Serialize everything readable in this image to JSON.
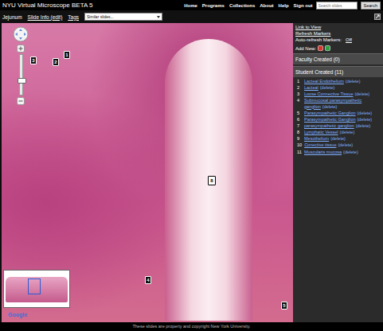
{
  "header": {
    "title": "NYU Virtual Microscope BETA 5",
    "nav": [
      "Home",
      "Programs",
      "Collections",
      "About",
      "Help",
      "Sign out"
    ],
    "search": {
      "placeholder": "Search slides",
      "button": "Search"
    }
  },
  "toolbar": {
    "slide": "Jejunum",
    "slide_info": "Slide Info (edit)",
    "tags": "Tags",
    "similar": "Similar slides..."
  },
  "viewer": {
    "zoom": {
      "level": 0.35
    },
    "map_logo": "Google",
    "markers": [
      {
        "label": "1",
        "selected": false
      },
      {
        "label": "2",
        "selected": false
      },
      {
        "label": "3",
        "selected": false
      },
      {
        "label": "8",
        "selected": true
      },
      {
        "label": "4",
        "selected": false
      },
      {
        "label": "5",
        "selected": false
      }
    ]
  },
  "sidebar": {
    "links": [
      "Link to View",
      "Refresh Markers"
    ],
    "auto_refresh": {
      "label": "Auto-refresh Markers:",
      "value": "Off"
    },
    "add_new": {
      "label": "Add New:",
      "buttons": [
        {
          "color": "#d9342b"
        },
        {
          "color": "#2ea043"
        }
      ]
    },
    "sections": [
      {
        "title": "Faculty Created (0)",
        "expanded": false
      },
      {
        "title": "Student Created (11)",
        "expanded": true
      }
    ],
    "items": [
      {
        "number": "1",
        "name": "Lacteal Endothelium",
        "action": "(delete)"
      },
      {
        "number": "2",
        "name": "Lacteal",
        "action": "(delete)"
      },
      {
        "number": "3",
        "name": "Loose Connective Tissue",
        "action": "(delete)"
      },
      {
        "number": "4",
        "name": "Submucosal parasympathetic ganglion",
        "action": "(delete)"
      },
      {
        "number": "5",
        "name": "Parasympathetic Ganglion",
        "action": "(delete)"
      },
      {
        "number": "6",
        "name": "Parasympathetic Ganglion",
        "action": "(delete)"
      },
      {
        "number": "7",
        "name": "parasympathetic ganglion",
        "action": "(delete)"
      },
      {
        "number": "8",
        "name": "Lymphatic Vessel",
        "action": "(delete)"
      },
      {
        "number": "9",
        "name": "Mesothelium",
        "action": "(delete)"
      },
      {
        "number": "10",
        "name": "Conective tissue",
        "action": "(delete)"
      },
      {
        "number": "11",
        "name": "Muscularis mucosa",
        "action": "(delete)"
      }
    ]
  },
  "footer": "These slides are property and copyright New York University."
}
